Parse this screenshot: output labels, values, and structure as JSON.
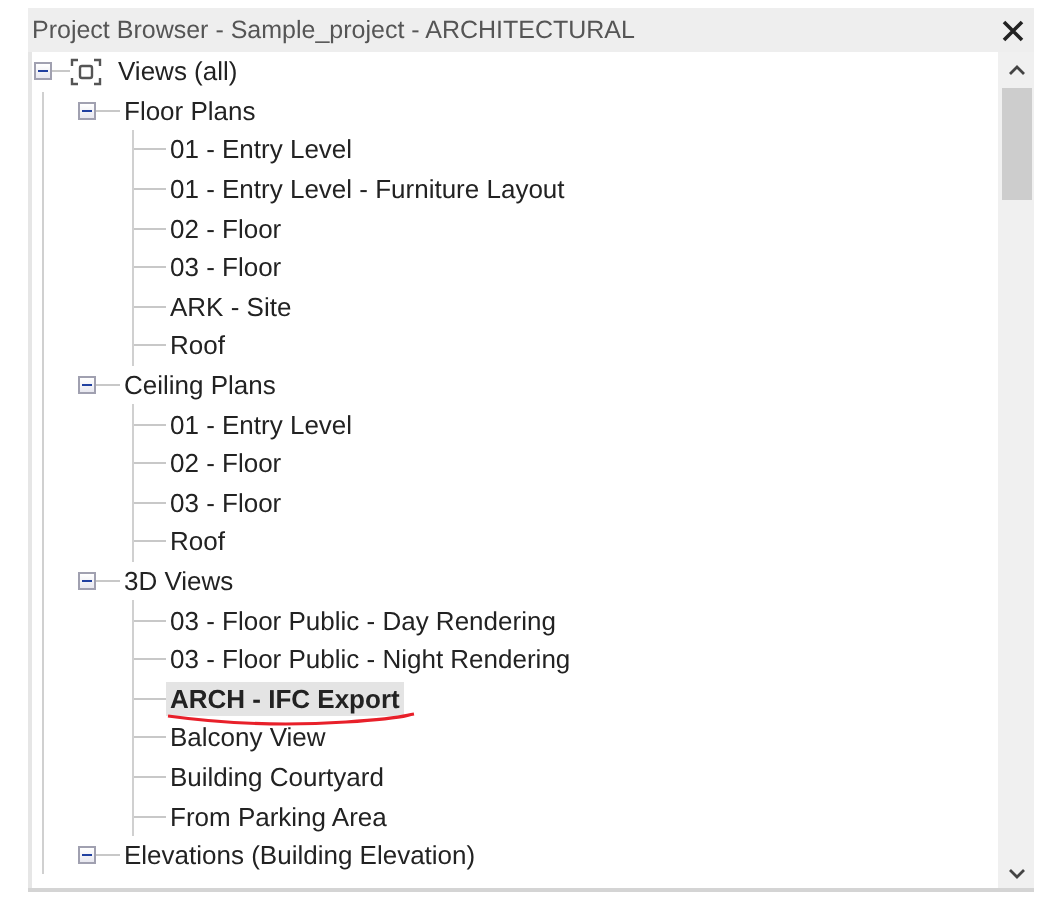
{
  "window": {
    "title": "Project Browser - Sample_project - ARCHITECTURAL"
  },
  "tree": [
    {
      "label": "Views (all)",
      "expanded": true,
      "children": [
        {
          "label": "Floor Plans",
          "expanded": true,
          "children": [
            {
              "label": "01 - Entry Level",
              "selected": false,
              "annotated": false
            },
            {
              "label": "01 - Entry Level - Furniture Layout",
              "selected": false,
              "annotated": false
            },
            {
              "label": "02 - Floor",
              "selected": false,
              "annotated": false
            },
            {
              "label": "03 - Floor",
              "selected": false,
              "annotated": false
            },
            {
              "label": "ARK - Site",
              "selected": false,
              "annotated": false
            },
            {
              "label": "Roof",
              "selected": false,
              "annotated": false
            }
          ]
        },
        {
          "label": "Ceiling Plans",
          "expanded": true,
          "children": [
            {
              "label": "01 - Entry Level",
              "selected": false,
              "annotated": false
            },
            {
              "label": "02 - Floor",
              "selected": false,
              "annotated": false
            },
            {
              "label": "03 - Floor",
              "selected": false,
              "annotated": false
            },
            {
              "label": "Roof",
              "selected": false,
              "annotated": false
            }
          ]
        },
        {
          "label": "3D Views",
          "expanded": true,
          "children": [
            {
              "label": "03 - Floor Public - Day Rendering",
              "selected": false,
              "annotated": false
            },
            {
              "label": "03 - Floor Public - Night Rendering",
              "selected": false,
              "annotated": false
            },
            {
              "label": "ARCH - IFC Export",
              "selected": true,
              "annotated": true
            },
            {
              "label": "Balcony View",
              "selected": false,
              "annotated": false
            },
            {
              "label": "Building Courtyard",
              "selected": false,
              "annotated": false
            },
            {
              "label": "From Parking Area",
              "selected": false,
              "annotated": false
            }
          ]
        },
        {
          "label": "Elevations (Building Elevation)",
          "expanded": true
        }
      ]
    }
  ]
}
